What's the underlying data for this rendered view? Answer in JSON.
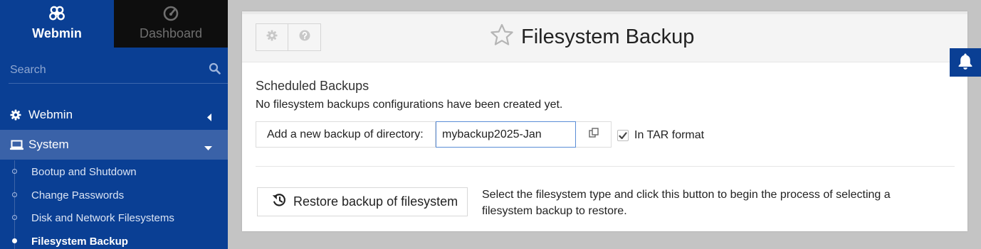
{
  "sidebar": {
    "tabs": [
      {
        "label": "Webmin",
        "icon": "webmin-logo-icon",
        "active": true
      },
      {
        "label": "Dashboard",
        "icon": "gauge-icon",
        "active": false
      }
    ],
    "search": {
      "placeholder": "Search",
      "icon": "search-icon"
    },
    "categories": [
      {
        "label": "Webmin",
        "icon": "gear-icon",
        "expanded": false
      },
      {
        "label": "System",
        "icon": "laptop-icon",
        "expanded": true
      }
    ],
    "system_items": [
      {
        "label": "Bootup and Shutdown",
        "active": false
      },
      {
        "label": "Change Passwords",
        "active": false
      },
      {
        "label": "Disk and Network Filesystems",
        "active": false
      },
      {
        "label": "Filesystem Backup",
        "active": true
      }
    ]
  },
  "header": {
    "title": "Filesystem Backup",
    "favorite_icon": "star-outline-icon",
    "buttons": [
      {
        "icon": "gear-icon"
      },
      {
        "icon": "help-icon"
      }
    ]
  },
  "main": {
    "section_title": "Scheduled Backups",
    "section_note": "No filesystem backups configurations have been created yet.",
    "add_label": "Add a new backup of directory:",
    "dir_value": "mybackup2025-Jan",
    "tar_label": "In TAR format",
    "tar_checked": true,
    "restore_button_label": "Restore backup of filesystem",
    "restore_description": "Select the filesystem type and click this button to begin the process of selecting a filesystem backup to restore."
  },
  "colors": {
    "sidebar_bg": "#0a3f94",
    "sidebar_active_item": "#3a62a8",
    "page_bg": "#c4c4c4",
    "input_focus_border": "#5a8dd6"
  },
  "notifications": {
    "icon": "bell-icon"
  }
}
